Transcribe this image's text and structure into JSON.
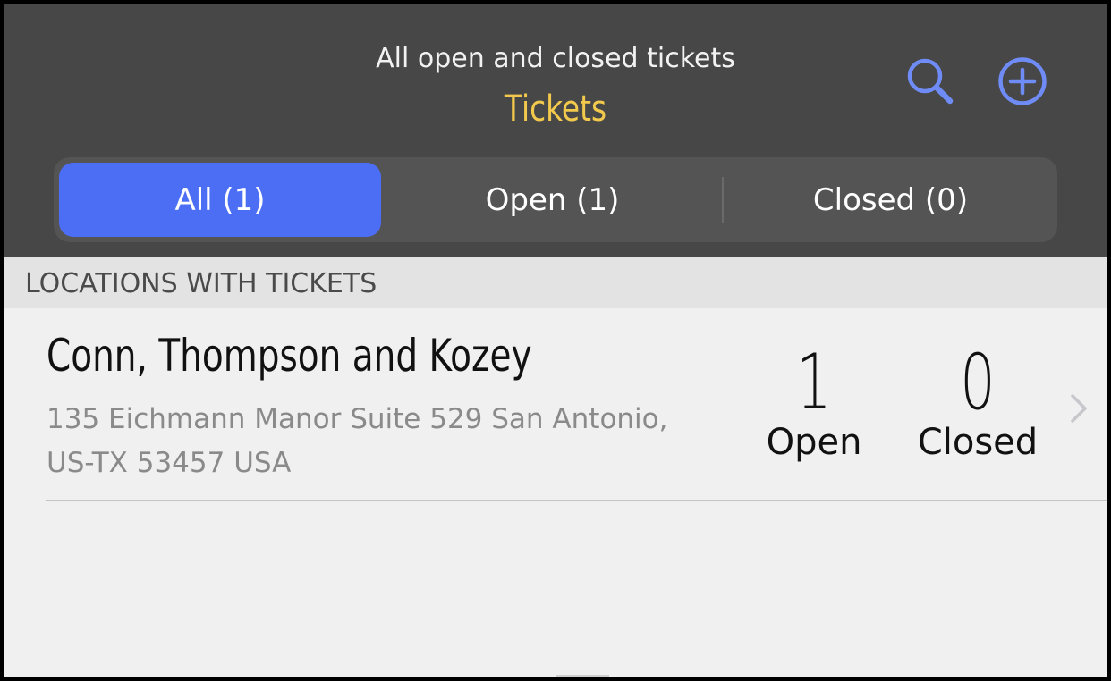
{
  "header": {
    "subtitle": "All open and closed tickets",
    "title": "Tickets",
    "title_color": "#f2c94c",
    "search_icon": "search-icon",
    "add_icon": "add-circle-icon",
    "icon_color": "#6f8cf6"
  },
  "segments": {
    "active_color": "#4c6ef5",
    "items": [
      {
        "label": "All (1)",
        "active": true
      },
      {
        "label": "Open (1)",
        "active": false
      },
      {
        "label": "Closed (0)",
        "active": false
      }
    ]
  },
  "section": {
    "label": "LOCATIONS WITH TICKETS"
  },
  "locations": [
    {
      "name": "Conn, Thompson and Kozey",
      "address_line1": "135 Eichmann Manor Suite 529 San Antonio,",
      "address_line2": "US-TX 53457 USA",
      "open_count": "1",
      "open_label": "Open",
      "closed_count": "0",
      "closed_label": "Closed",
      "chevron_icon": "chevron-right-icon"
    }
  ]
}
